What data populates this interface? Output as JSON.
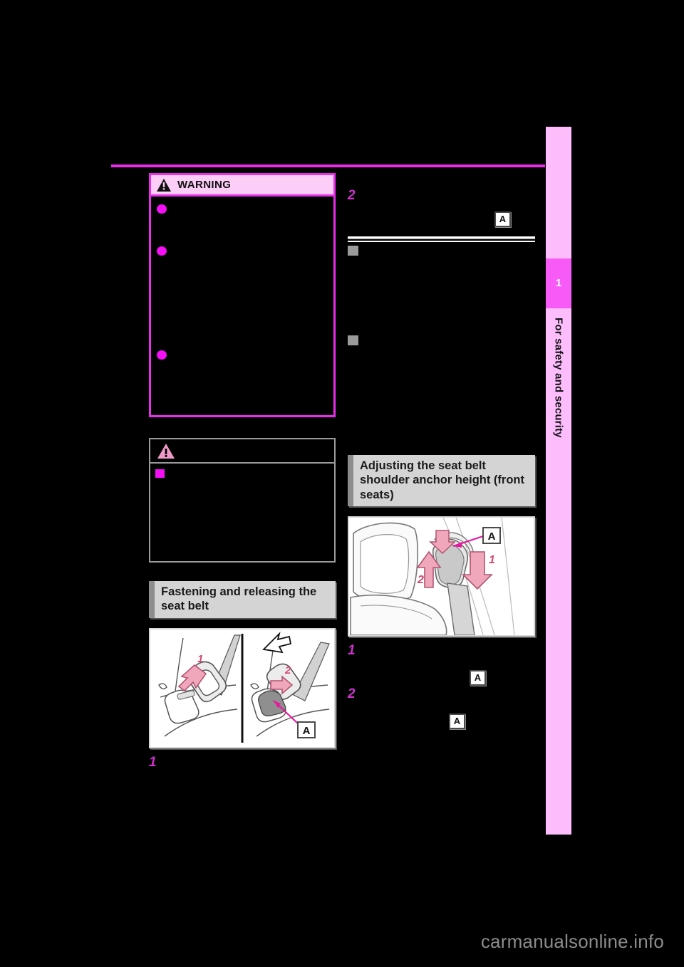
{
  "document": {
    "kind": "car-owners-manual-page",
    "watermark": "carmanualsonline.info",
    "watermark_tld": ".info"
  },
  "sidebar": {
    "chapter_number": "1",
    "chapter_title": "For safety and security",
    "tab_color": "#f75af7",
    "band_color": "#fdbdfd"
  },
  "colors": {
    "warning_border": "#e92de9",
    "warning_header_bg": "#fbcdf7",
    "step_number": "#cc33cc",
    "section_header_bg": "#d4d4d4",
    "section_header_bar": "#8d8d8d",
    "bullet_magenta": "#f40ff4",
    "bullet_gray": "#9a9a9a",
    "top_rule": "#e92de9"
  },
  "left_column": {
    "warning_box": {
      "title": "WARNING",
      "icon": "warning-triangle-icon",
      "bullets": [
        "",
        "",
        ""
      ]
    },
    "notice_box": {
      "title": "",
      "icon": "notice-triangle-icon",
      "bullets": [
        ""
      ]
    },
    "section_heading": "Fastening and releasing the seat belt",
    "figure": {
      "name": "seat-belt-buckle-illustration",
      "panels": [
        {
          "label": "1",
          "caption": ""
        },
        {
          "label": "2",
          "caption": "",
          "callout": "A"
        }
      ]
    },
    "steps": [
      {
        "number": "1",
        "text": ""
      }
    ]
  },
  "right_column": {
    "steps_top": [
      {
        "number": "2",
        "text": "",
        "callout": "A"
      }
    ],
    "subsection_heading": "",
    "bullets": [
      "",
      ""
    ],
    "section_heading": "Adjusting the seat belt shoulder anchor height (front seats)",
    "figure": {
      "name": "shoulder-anchor-illustration",
      "labels": [
        "1",
        "2"
      ],
      "callout": "A"
    },
    "steps_bottom": [
      {
        "number": "1",
        "text": "",
        "callout": "A"
      },
      {
        "number": "2",
        "text": "",
        "callout": "A"
      }
    ]
  }
}
